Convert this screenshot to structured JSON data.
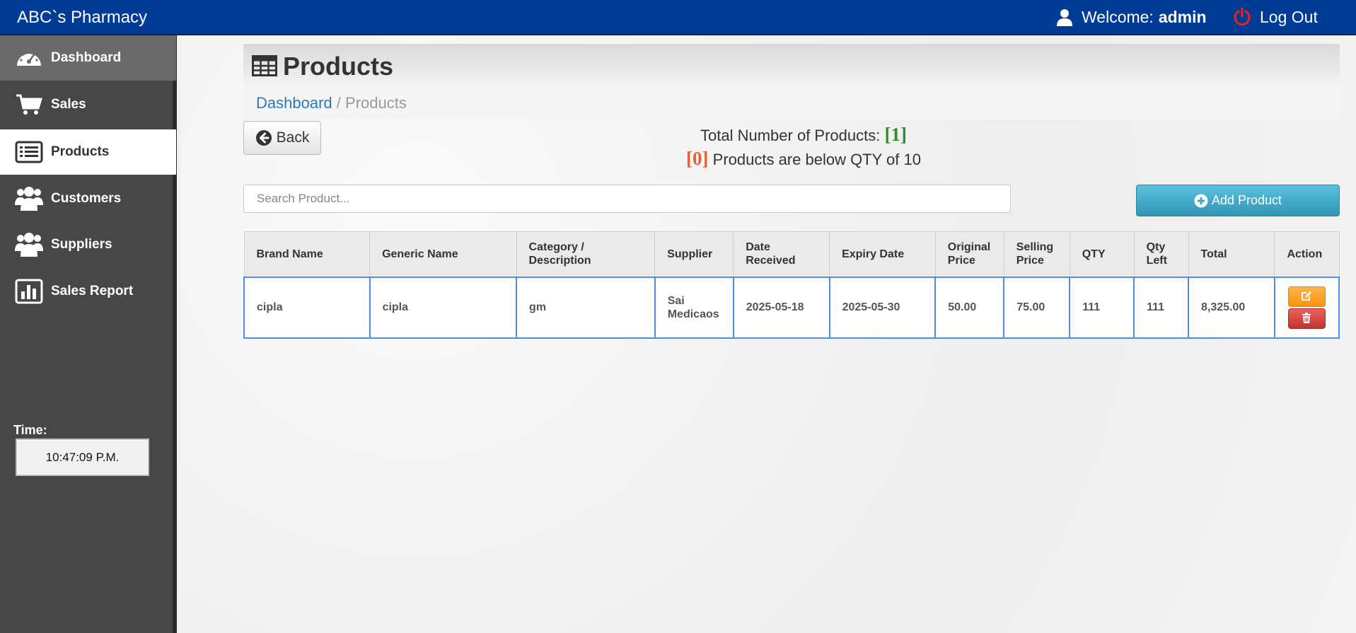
{
  "app": {
    "brand": "ABC`s Pharmacy"
  },
  "header": {
    "welcome_prefix": "Welcome:",
    "username": "admin",
    "logout_label": "Log Out"
  },
  "sidebar": {
    "items": [
      {
        "label": "Dashboard",
        "icon": "gauge-icon"
      },
      {
        "label": "Sales",
        "icon": "cart-icon"
      },
      {
        "label": "Products",
        "icon": "list-icon"
      },
      {
        "label": "Customers",
        "icon": "users-icon"
      },
      {
        "label": "Suppliers",
        "icon": "users-icon"
      },
      {
        "label": "Sales Report",
        "icon": "bar-chart-icon"
      }
    ],
    "time_label": "Time:",
    "time_value": "10:47:09 P.M."
  },
  "page": {
    "title": "Products",
    "breadcrumb_home": "Dashboard",
    "breadcrumb_sep": "/",
    "breadcrumb_current": "Products",
    "back_label": "Back",
    "total_label": "Total Number of Products:",
    "total_value": "[1]",
    "below_value": "[0]",
    "below_label": "Products are below QTY of 10",
    "search_placeholder": "Search Product...",
    "add_label": "Add Product"
  },
  "table": {
    "headers": [
      "Brand Name",
      "Generic Name",
      "Category / Description",
      "Supplier",
      "Date Received",
      "Expiry Date",
      "Original Price",
      "Selling Price",
      "QTY",
      "Qty Left",
      "Total",
      "Action"
    ],
    "rows": [
      {
        "brand": "cipla",
        "generic": "cipla",
        "category": "gm",
        "supplier": "Sai Medicaos",
        "date_received": "2025-05-18",
        "expiry": "2025-05-30",
        "original_price": "50.00",
        "selling_price": "75.00",
        "qty": "111",
        "qty_left": "111",
        "total": "8,325.00"
      }
    ]
  },
  "colors": {
    "navbar": "#003b96",
    "sidebar": "#474747",
    "add_button": "#3aa8c8",
    "edit_button": "#f89406",
    "delete_button": "#d9534f"
  }
}
